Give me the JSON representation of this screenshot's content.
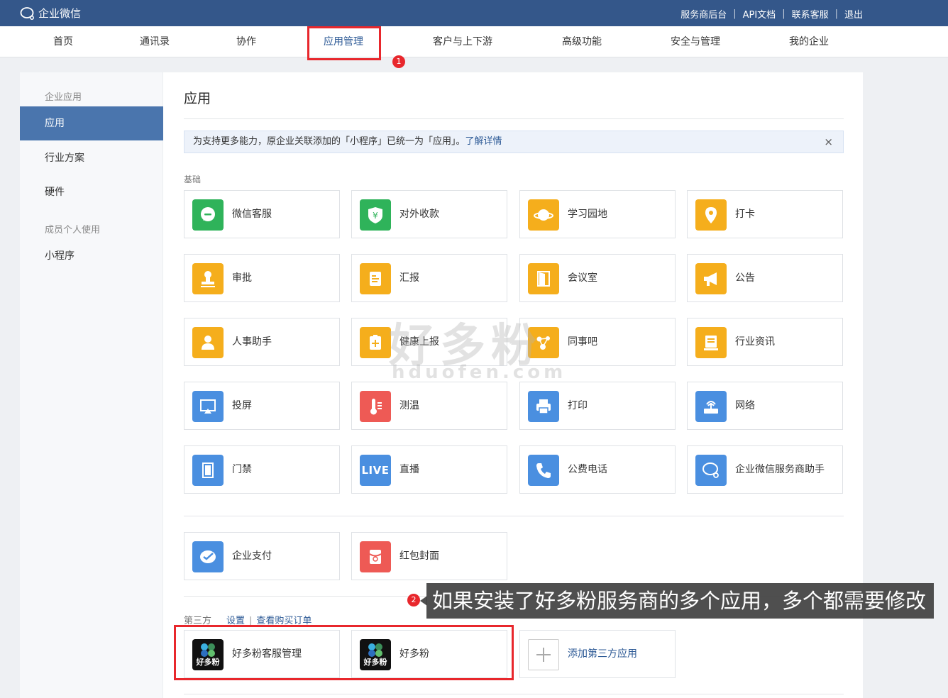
{
  "topbar": {
    "logo_text": "企业微信",
    "links": [
      "服务商后台",
      "API文档",
      "联系客服",
      "退出"
    ]
  },
  "nav": {
    "items": [
      "首页",
      "通讯录",
      "协作",
      "应用管理",
      "客户与上下游",
      "高级功能",
      "安全与管理",
      "我的企业"
    ],
    "active": "应用管理"
  },
  "annotations": {
    "badge1": "1",
    "badge2": "2",
    "tip": "如果安装了好多粉服务商的多个应用，多个都需要修改"
  },
  "watermark": {
    "main": "好多粉",
    "sub": "hduofen.com"
  },
  "sidebar": {
    "group1": "企业应用",
    "items1": [
      "应用",
      "行业方案",
      "硬件"
    ],
    "group2": "成员个人使用",
    "items2": [
      "小程序"
    ]
  },
  "main": {
    "title": "应用",
    "notice_text": "为支持更多能力，原企业关联添加的「小程序」已统一为「应用」。",
    "notice_link": "了解详情",
    "notice_close": "×",
    "section_basic": "基础",
    "basic_apps": [
      "微信客服",
      "对外收款",
      "学习园地",
      "打卡",
      "审批",
      "汇报",
      "会议室",
      "公告",
      "人事助手",
      "健康上报",
      "同事吧",
      "行业资讯",
      "投屏",
      "测温",
      "打印",
      "网络",
      "门禁",
      "直播",
      "公费电话",
      "企业微信服务商助手"
    ],
    "live_text": "LIVE",
    "extra_apps": [
      "企业支付",
      "红包封面"
    ],
    "section_third": "第三方",
    "third_links": [
      "设置",
      "查看购买订单"
    ],
    "third_apps": [
      "好多粉客服管理",
      "好多粉"
    ],
    "third_logo_text": "好多粉",
    "add_app": "添加第三方应用"
  },
  "colors": {
    "topbar": "#34578a",
    "active_sidebar": "#4a75ad",
    "link": "#2d5a96",
    "highlight": "#e8272c",
    "green": "#2fb35a",
    "yellow": "#f5ae1c",
    "blue": "#4a8fe0",
    "red": "#ee5a55"
  }
}
